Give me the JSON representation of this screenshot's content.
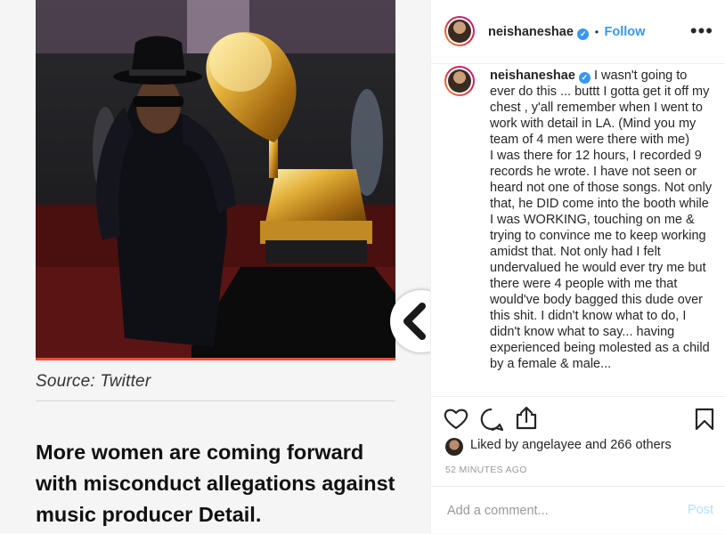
{
  "article": {
    "caption": "Source: Twitter",
    "headline": "More women are coming forward with misconduct allegations against music producer Detail."
  },
  "nav": {
    "icon": "chevron-left-icon"
  },
  "post": {
    "username": "neishaneshae",
    "follow_label": "Follow",
    "separator": "•",
    "more_label": "•••",
    "verified_mark": "✓",
    "comment_text": "I wasn't going to ever do this ... buttt I gotta get it off my chest , y'all remember when I went to work with detail in LA. (Mind you my team of 4 men were there with me)\nI was there for 12 hours, I recorded 9 records he wrote. I have not seen or heard not one of those songs. Not only that, he DID come into the booth while I was WORKING, touching on me & trying to convince me to keep working amidst that. Not only had I felt undervalued he would ever try me but there were 4 people with me that would've body bagged this dude over this shit. I didn't know what to do, I didn't know what to say... having experienced being molested as a child by a female & male...",
    "likes_prefix": "Liked by ",
    "likes_user": "angelayee",
    "likes_suffix": " and ",
    "likes_count": "266 others",
    "time": "52 MINUTES AGO",
    "comment_placeholder": "Add a comment...",
    "post_label": "Post",
    "accent": "#3897f0"
  }
}
